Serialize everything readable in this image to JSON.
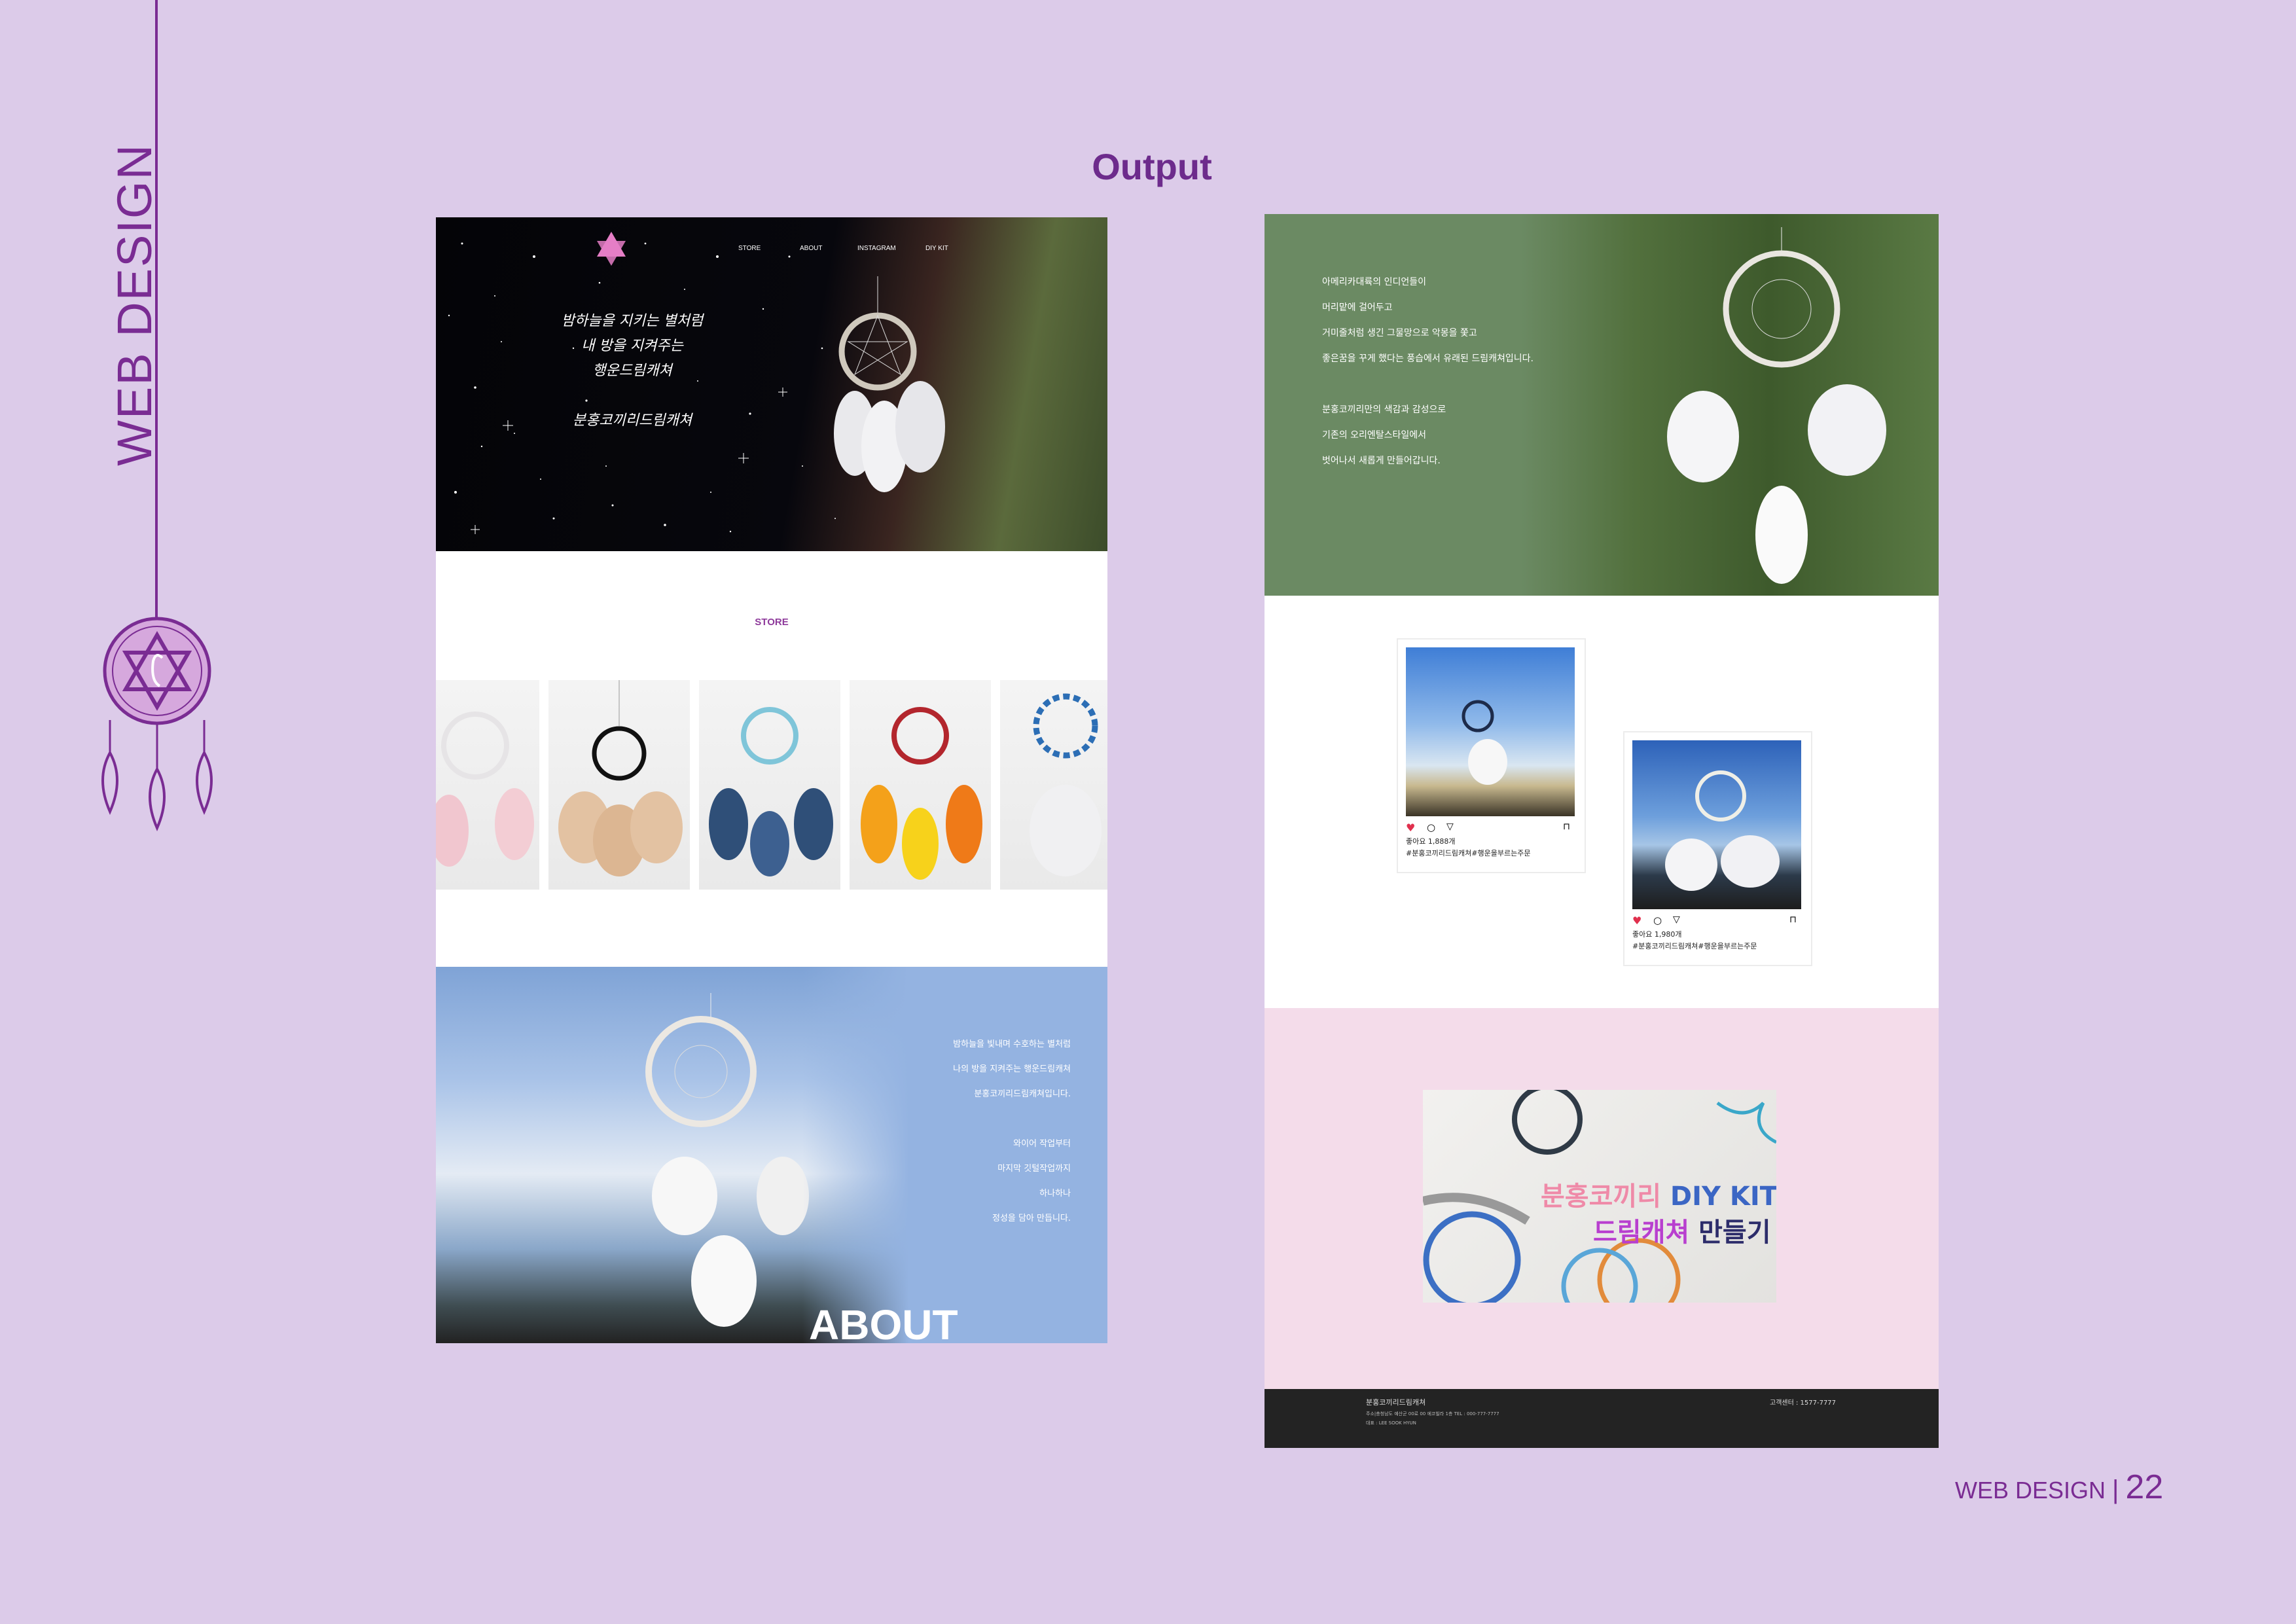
{
  "section_title": "WEB DESIGN",
  "output_title": "Output",
  "colors": {
    "background": "#dccbe9",
    "accent": "#7a2c93",
    "green_panel": "#6b8a63",
    "about_panel": "#94b3e1",
    "diy_panel": "#f4dcea",
    "footer": "#232323"
  },
  "left_mockup": {
    "nav": [
      "STORE",
      "ABOUT",
      "INSTAGRAM",
      "DIY KIT"
    ],
    "hero_lines": [
      "밤하늘을 지키는 별처럼",
      "내 방을 지켜주는",
      "행운드림캐쳐",
      "분홍코끼리드림캐쳐"
    ],
    "store_title": "STORE",
    "about_lines": [
      "밤하늘을 빛내며 수호하는 별처럼",
      "나의 방을 지켜주는 행운드림캐쳐",
      "분홍코끼리드림캐쳐입니다.",
      "와이어 작업부터",
      "마지막 깃털작업까지",
      "하나하나",
      "정성을 담아 만듭니다."
    ],
    "about_label": "ABOUT"
  },
  "right_mockup": {
    "intro_lines": [
      "아메리카대륙의 인디언들이",
      "머리맡에 걸어두고",
      "거미줄처럼 생긴 그물망으로 악몽을 쫓고",
      "좋은꿈을 꾸게 했다는 풍습에서 유래된 드림캐쳐입니다.",
      "분홍코끼리만의 색감과 감성으로",
      "기존의 오리엔탈스타일에서",
      "벗어나서 새롭게 만들어갑니다."
    ],
    "posts": [
      {
        "likes": "좋아요 1,888개",
        "tags": "#분홍코끼리드림캐쳐#행운을부르는주문"
      },
      {
        "likes": "좋아요 1,980개",
        "tags": "#분홍코끼리드림캐쳐#행운을부르는주문"
      }
    ],
    "diy_banner": {
      "line1_part1": "분홍코끼리",
      "line1_part2": " DIY KIT",
      "line2_part1": "드림캐쳐",
      "line2_part2": " 만들기"
    },
    "footer": {
      "company": "분홍코끼리드림캐쳐",
      "address": "주소|충청남도 예산군 00로 00 에코빌라 1층  TEL : 000-777-7777",
      "ceo": "대표 : LEE SOOK HYUN",
      "service": "고객센터 : 1577-7777"
    }
  },
  "page_label": {
    "text": "WEB DESIGN",
    "separator": "|",
    "number": "22"
  }
}
